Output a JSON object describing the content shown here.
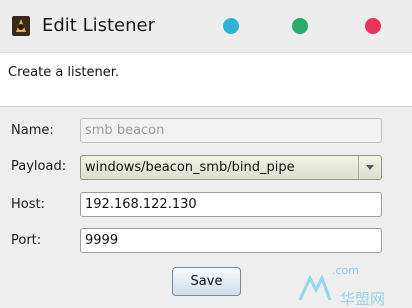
{
  "window": {
    "title": "Edit Listener",
    "icon": "cobalt-strike-app-icon",
    "controls": [
      {
        "name": "minimize",
        "color": "#29b6d8"
      },
      {
        "name": "maximize",
        "color": "#2aa96b"
      },
      {
        "name": "close",
        "color": "#e8345a"
      }
    ]
  },
  "description": "Create a listener.",
  "form": {
    "name": {
      "label": "Name:",
      "value": "smb beacon"
    },
    "payload": {
      "label": "Payload:",
      "value": "windows/beacon_smb/bind_pipe"
    },
    "host": {
      "label": "Host:",
      "value": "192.168.122.130"
    },
    "port": {
      "label": "Port:",
      "value": "9999"
    }
  },
  "save_label": "Save",
  "watermark": {
    "top_text": ".com",
    "main_text": "华盟网"
  }
}
